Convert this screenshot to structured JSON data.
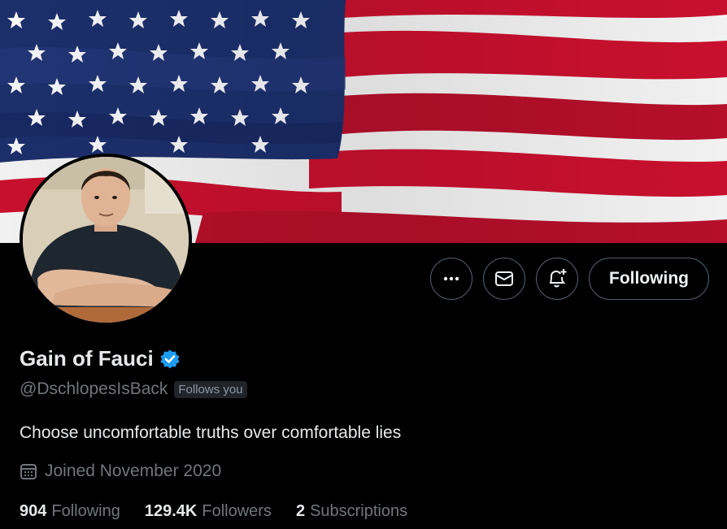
{
  "profile": {
    "display_name": "Gain of Fauci",
    "handle": "@DschlopesIsBack",
    "follows_you": "Follows you",
    "bio": "Choose uncomfortable truths over comfortable lies",
    "joined": "Joined November 2020",
    "verified_icon": "verified-badge-icon"
  },
  "actions": {
    "more_icon": "more-icon",
    "message_icon": "envelope-icon",
    "notify_icon": "bell-plus-icon",
    "follow_label": "Following"
  },
  "stats": [
    {
      "value": "904",
      "label": "Following"
    },
    {
      "value": "129.4K",
      "label": "Followers"
    },
    {
      "value": "2",
      "label": "Subscriptions"
    }
  ],
  "colors": {
    "background": "#000000",
    "verified": "#1d9bf0",
    "muted_text": "#71767b",
    "border": "#536471",
    "flag_red": "#c8102e",
    "flag_blue": "#1c2f6b"
  }
}
